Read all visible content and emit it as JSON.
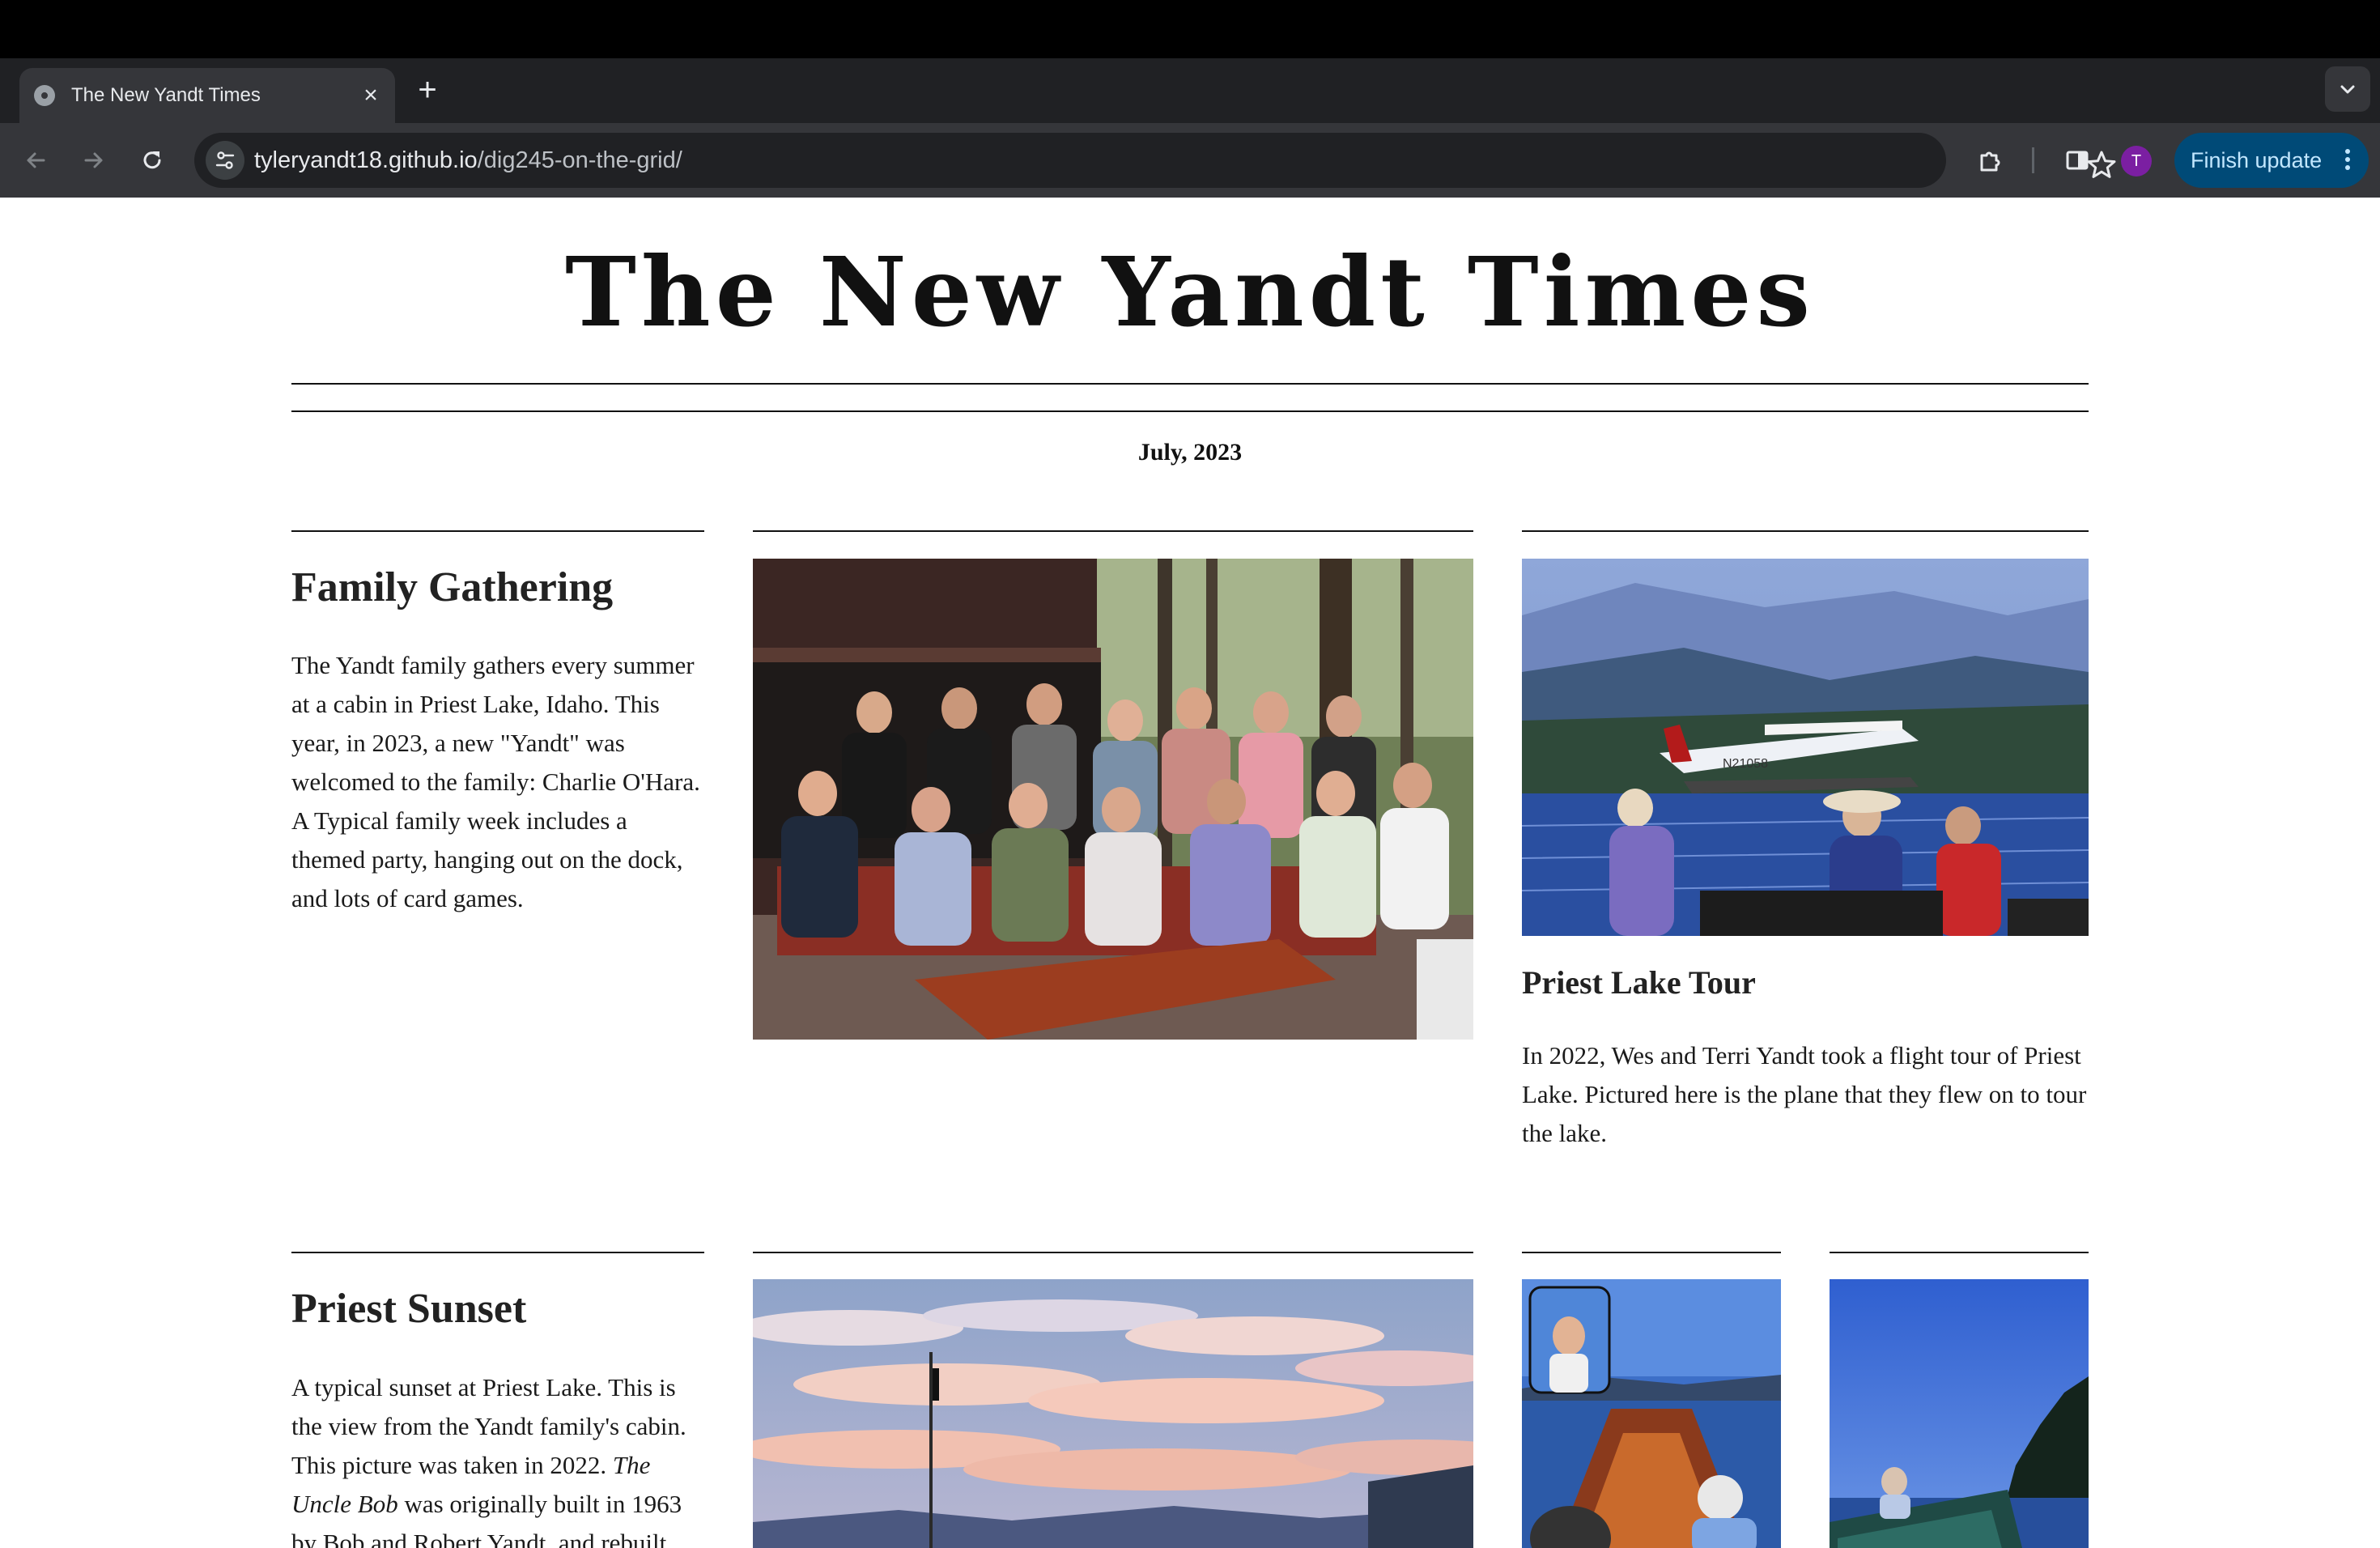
{
  "browser": {
    "tab_title": "The New Yandt Times",
    "tab_close": "×",
    "new_tab": "+",
    "url_host": "tyleryandt18.github.io",
    "url_path": "/dig245-on-the-grid/",
    "avatar_initial": "T",
    "update_label": "Finish update",
    "icons": [
      "globe-icon",
      "close-icon",
      "plus-icon",
      "chevron-down-icon",
      "back-arrow-icon",
      "forward-arrow-icon",
      "reload-icon",
      "tune-icon",
      "star-icon",
      "extensions-icon",
      "side-panel-icon",
      "kebab-menu-icon"
    ],
    "colors": {
      "toolbar": "#35363a",
      "tabstrip": "#202124",
      "update_button": "#004a77",
      "avatar": "#7b1fa2"
    }
  },
  "page": {
    "masthead": "The New Yandt Times",
    "dateline": "July, 2023",
    "articles": [
      {
        "headline": "Family Gathering",
        "body": "The Yandt family gathers every summer at a cabin in Priest Lake, Idaho. This year, in 2023, a new \"Yandt\" was welcomed to the family: Charlie O'Hara. A Typical family week includes a themed party, hanging out on the dock, and lots of card games."
      },
      {
        "headline": "Priest Lake Tour",
        "body": "In 2022, Wes and Terri Yandt took a flight tour of Priest Lake. Pictured here is the plane that they flew on to tour the lake.",
        "plane_registration": "N21058"
      },
      {
        "headline": "Priest Sunset",
        "body_before": "A typical sunset at Priest Lake. This is the view from the Yandt family's cabin. This picture was taken in 2022. ",
        "body_italic": "The Uncle Bob",
        "body_after": " was originally built in 1963 by Bob and Robert Yandt, and rebuilt"
      }
    ]
  }
}
